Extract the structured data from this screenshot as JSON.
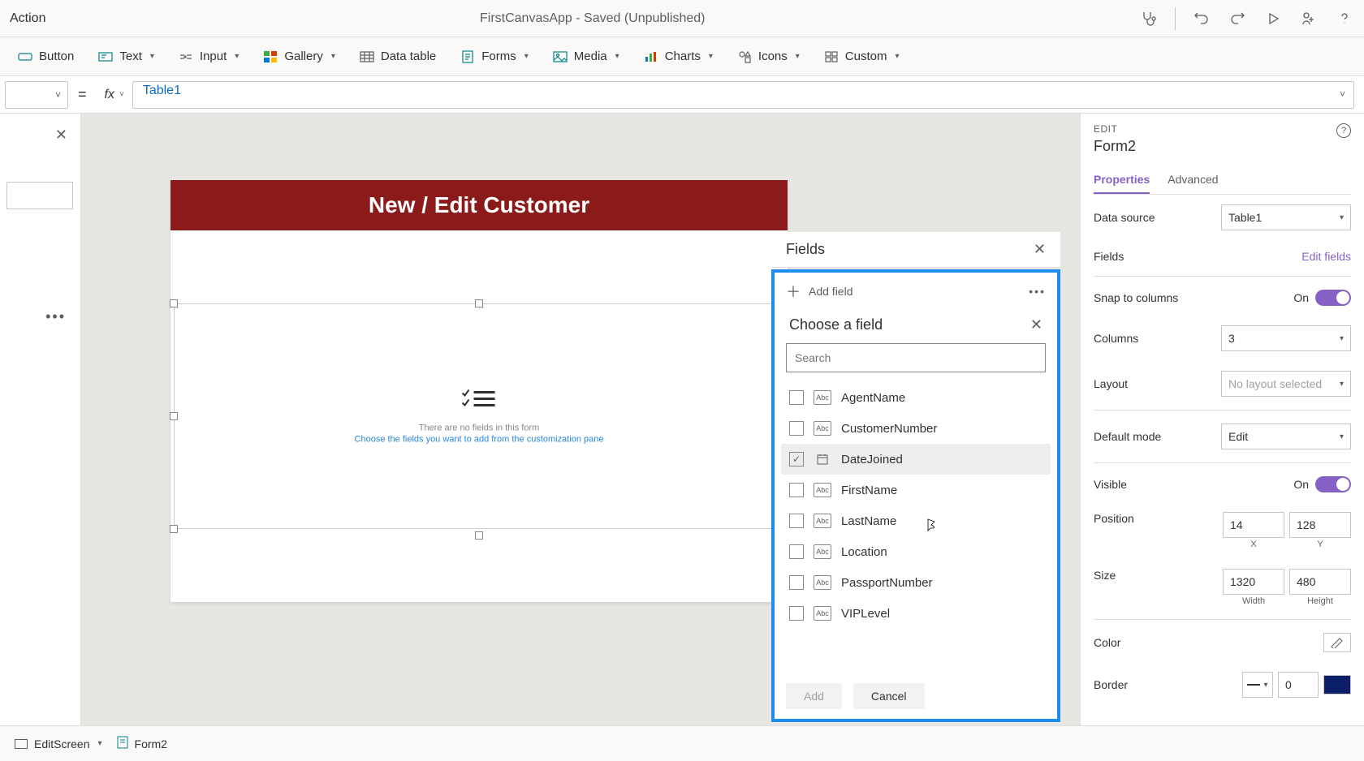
{
  "titlebar": {
    "left": "Action",
    "center": "FirstCanvasApp - Saved (Unpublished)"
  },
  "ribbon": {
    "button": "Button",
    "text": "Text",
    "input": "Input",
    "gallery": "Gallery",
    "datatable": "Data table",
    "forms": "Forms",
    "media": "Media",
    "charts": "Charts",
    "icons": "Icons",
    "custom": "Custom"
  },
  "formula": {
    "value": "Table1"
  },
  "canvas": {
    "header": "New / Edit Customer",
    "empty_line1": "There are no fields in this form",
    "empty_line2": "Choose the fields you want to add from the customization pane"
  },
  "fieldsPanel": {
    "title": "Fields",
    "addField": "Add field",
    "chooseField": "Choose a field",
    "searchPlaceholder": "Search",
    "items": [
      {
        "name": "AgentName",
        "type": "abc",
        "checked": false,
        "hover": false
      },
      {
        "name": "CustomerNumber",
        "type": "abc",
        "checked": false,
        "hover": false
      },
      {
        "name": "DateJoined",
        "type": "date",
        "checked": true,
        "hover": true
      },
      {
        "name": "FirstName",
        "type": "abc",
        "checked": false,
        "hover": false
      },
      {
        "name": "LastName",
        "type": "abc",
        "checked": false,
        "hover": false
      },
      {
        "name": "Location",
        "type": "abc",
        "checked": false,
        "hover": false
      },
      {
        "name": "PassportNumber",
        "type": "abc",
        "checked": false,
        "hover": false
      },
      {
        "name": "VIPLevel",
        "type": "abc",
        "checked": false,
        "hover": false
      }
    ],
    "addBtn": "Add",
    "cancelBtn": "Cancel"
  },
  "rightPane": {
    "editLabel": "EDIT",
    "formName": "Form2",
    "tabProperties": "Properties",
    "tabAdvanced": "Advanced",
    "dataSourceLabel": "Data source",
    "dataSourceValue": "Table1",
    "fieldsLabel": "Fields",
    "editFields": "Edit fields",
    "snapLabel": "Snap to columns",
    "snapValue": "On",
    "columnsLabel": "Columns",
    "columnsValue": "3",
    "layoutLabel": "Layout",
    "layoutValue": "No layout selected",
    "defaultModeLabel": "Default mode",
    "defaultModeValue": "Edit",
    "visibleLabel": "Visible",
    "visibleValue": "On",
    "positionLabel": "Position",
    "posX": "14",
    "posY": "128",
    "posXL": "X",
    "posYL": "Y",
    "sizeLabel": "Size",
    "sizeW": "1320",
    "sizeH": "480",
    "sizeWL": "Width",
    "sizeHL": "Height",
    "colorLabel": "Color",
    "borderLabel": "Border",
    "borderWidth": "0"
  },
  "breadcrumb": {
    "screen": "EditScreen",
    "form": "Form2"
  }
}
